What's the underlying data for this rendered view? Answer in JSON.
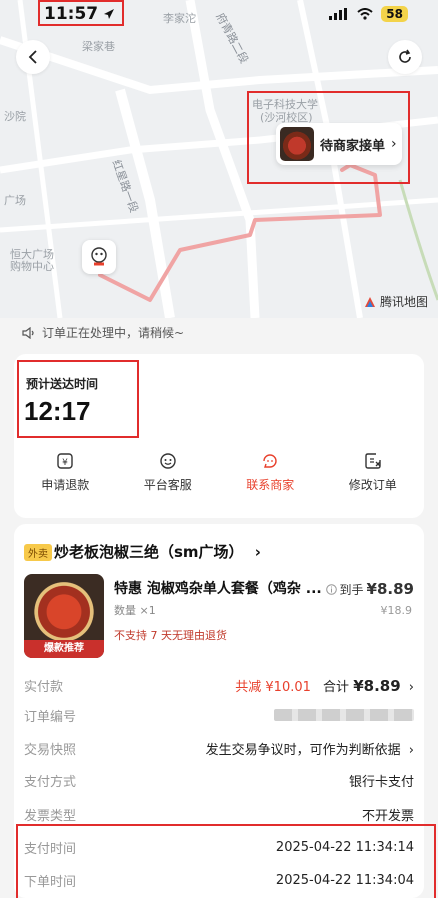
{
  "status_bar": {
    "time": "11:57",
    "battery": "58"
  },
  "map": {
    "labels": [
      "李家沱",
      "梁家巷",
      "电子科技大学",
      "(沙河校区)",
      "沙院",
      "广场",
      "恒大广场",
      "购物中心"
    ],
    "roads": [
      "府青路二段",
      "红星路一段"
    ],
    "provider": "腾讯地图"
  },
  "merchant_status": "待商家接单",
  "processing_note": "订单正在处理中，请稍候~",
  "eta": {
    "label": "预计送达时间",
    "time": "12:17"
  },
  "actions": [
    {
      "label": "申请退款",
      "icon": "refund-icon"
    },
    {
      "label": "平台客服",
      "icon": "customer-service-icon"
    },
    {
      "label": "联系商家",
      "icon": "merchant-chat-icon",
      "active": true
    },
    {
      "label": "修改订单",
      "icon": "edit-order-icon"
    }
  ],
  "shop": {
    "tag": "外卖",
    "name": "炒老板泡椒三绝（sm广场）"
  },
  "item": {
    "title": "特惠 泡椒鸡杂单人套餐（鸡杂 ...",
    "quantity": "数量 ×1",
    "note": "不支持 7 天无理由退货",
    "badge": "爆款推荐",
    "paid_label": "到手",
    "paid_value": "¥8.89",
    "original_price": "¥18.9"
  },
  "details": {
    "actual_payment": {
      "label": "实付款",
      "discount": "共减 ¥10.01",
      "total_label": "合计",
      "total": "¥8.89"
    },
    "order_number": {
      "label": "订单编号"
    },
    "snapshot": {
      "label": "交易快照",
      "value": "发生交易争议时，可作为判断依据"
    },
    "payment_method": {
      "label": "支付方式",
      "value": "银行卡支付"
    },
    "invoice_type": {
      "label": "发票类型",
      "value": "不开发票"
    },
    "payment_time": {
      "label": "支付时间",
      "value": "2025-04-22 11:34:14"
    },
    "order_time": {
      "label": "下单时间",
      "value": "2025-04-22 11:34:04"
    }
  },
  "colors": {
    "accent": "#e8402c",
    "highlight_box": "#e12c2c"
  }
}
